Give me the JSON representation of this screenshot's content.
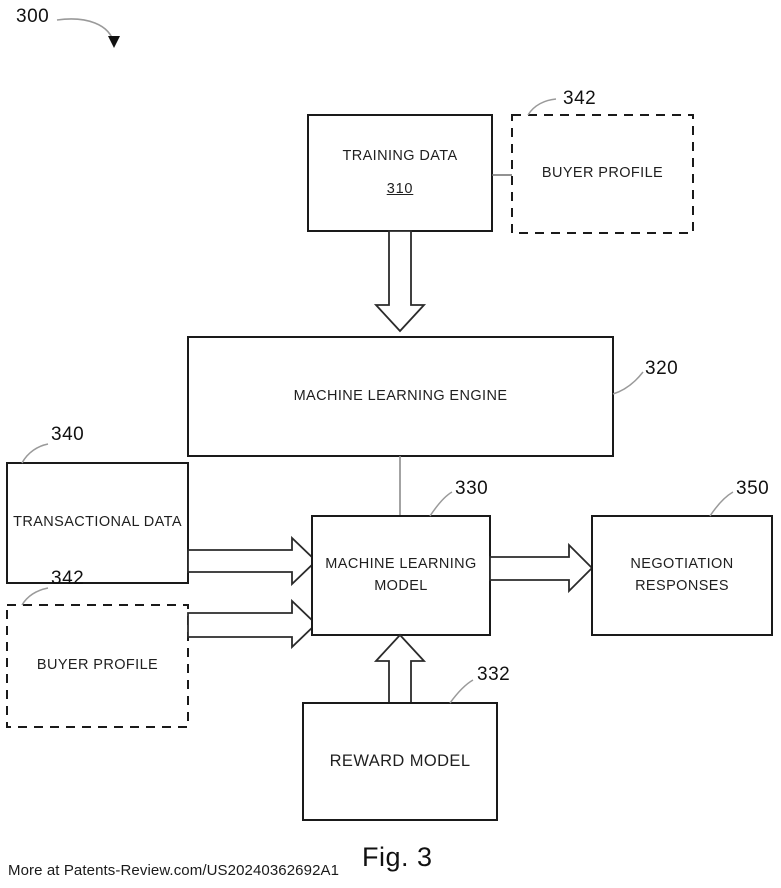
{
  "figure": {
    "number": "300",
    "caption": "Fig. 3",
    "footer": "More at Patents-Review.com/US20240362692A1"
  },
  "nodes": {
    "training_data": {
      "label": "TRAINING DATA",
      "id_label": "310",
      "ref": "310",
      "style": "solid"
    },
    "buyer_profile_top": {
      "label": "BUYER PROFILE",
      "ref": "342",
      "style": "dashed"
    },
    "ml_engine": {
      "label": "MACHINE LEARNING ENGINE",
      "ref": "320",
      "style": "solid"
    },
    "transactional_data": {
      "label": "TRANSACTIONAL DATA",
      "ref": "340",
      "style": "solid"
    },
    "buyer_profile_bottom": {
      "label": "BUYER PROFILE",
      "ref": "342",
      "style": "dashed"
    },
    "ml_model": {
      "label_line1": "MACHINE LEARNING",
      "label_line2": "MODEL",
      "ref": "330",
      "style": "solid"
    },
    "negotiation_responses": {
      "label_line1": "NEGOTIATION",
      "label_line2": "RESPONSES",
      "ref": "350",
      "style": "solid"
    },
    "reward_model": {
      "label": "REWARD MODEL",
      "ref": "332",
      "style": "solid"
    }
  },
  "connections": [
    {
      "from": "training_data",
      "to": "buyer_profile_top",
      "type": "thin-line"
    },
    {
      "from": "training_data",
      "to": "ml_engine",
      "type": "block-arrow-down"
    },
    {
      "from": "ml_engine",
      "to": "ml_model",
      "type": "thin-line"
    },
    {
      "from": "transactional_data",
      "to": "ml_model",
      "type": "block-arrow-right"
    },
    {
      "from": "buyer_profile_bottom",
      "to": "ml_model",
      "type": "block-arrow-right"
    },
    {
      "from": "ml_model",
      "to": "negotiation_responses",
      "type": "block-arrow-right"
    },
    {
      "from": "reward_model",
      "to": "ml_model",
      "type": "block-arrow-up"
    }
  ],
  "colors": {
    "stroke": "#1a1a1a",
    "leader": "#8a8a8a",
    "background": "#ffffff",
    "text": "#1f1f1f"
  }
}
